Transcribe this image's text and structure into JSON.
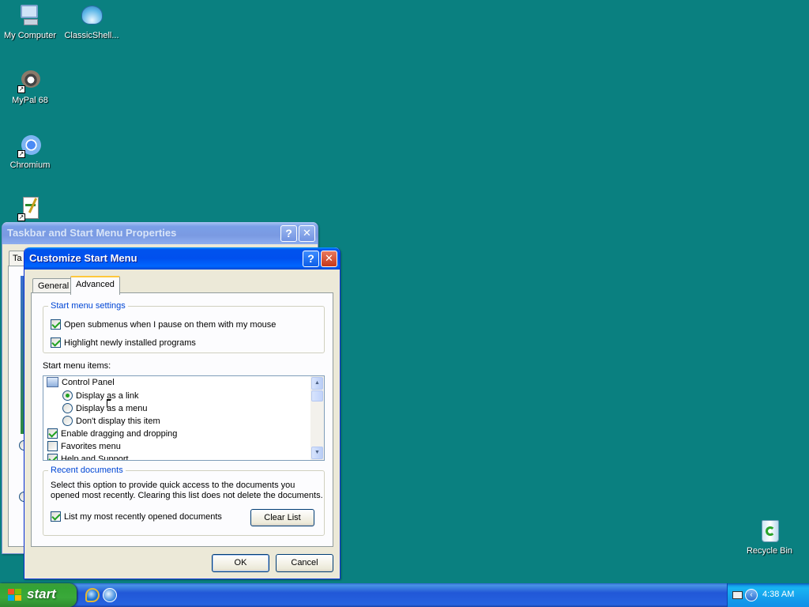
{
  "desktop": {
    "icons": [
      {
        "label": "My Computer",
        "icon": "my-computer-icon"
      },
      {
        "label": "ClassicShell...",
        "icon": "classic-shell-icon"
      },
      {
        "label": "MyPal 68",
        "icon": "mypal-icon"
      },
      {
        "label": "Chromium",
        "icon": "chromium-icon"
      },
      {
        "label": "",
        "icon": "app-shortcut-icon"
      },
      {
        "label": "Recycle Bin",
        "icon": "recycle-bin-icon"
      }
    ]
  },
  "taskbar_props": {
    "title": "Taskbar and Start Menu Properties",
    "help": "?",
    "close": "✕",
    "tab_stub": "Ta"
  },
  "customize": {
    "title": "Customize Start Menu",
    "help": "?",
    "close": "✕",
    "tabs": [
      "General",
      "Advanced"
    ],
    "start_menu_settings": {
      "title": "Start menu settings",
      "options": [
        {
          "label": "Open submenus when I pause on them with my mouse",
          "checked": true
        },
        {
          "label": "Highlight newly installed programs",
          "checked": true
        }
      ]
    },
    "items_label": "Start menu items:",
    "items": {
      "control_panel": "Control Panel",
      "radios": [
        {
          "label": "Display as a link",
          "selected": true
        },
        {
          "label": "Display as a menu",
          "selected": false
        },
        {
          "label": "Don't display this item",
          "selected": false
        }
      ],
      "checks": [
        {
          "label": "Enable dragging and dropping",
          "checked": true
        },
        {
          "label": "Favorites menu",
          "checked": false
        },
        {
          "label": "Help and Support",
          "checked": true
        }
      ]
    },
    "recent": {
      "title": "Recent documents",
      "description_line1": "Select this option to provide quick access to the documents you",
      "description_line2": "opened most recently.  Clearing this list does not delete the documents.",
      "list_label": "List my most recently opened documents",
      "list_checked": true,
      "clear_button": "Clear List"
    },
    "ok": "OK",
    "cancel": "Cancel"
  },
  "taskbar": {
    "start_label": "start",
    "quick_launch": [
      "internet-explorer-icon",
      "ie-alt-icon"
    ],
    "clock": "4:38 AM"
  }
}
